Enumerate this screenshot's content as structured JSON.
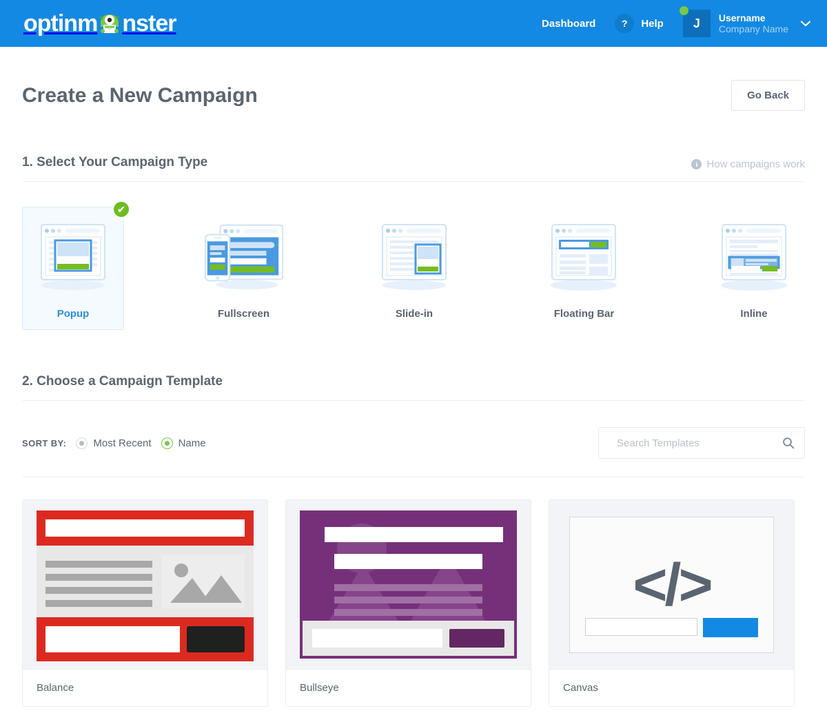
{
  "header": {
    "logo_text_before": "optinm",
    "logo_icon": "monster-mascot",
    "logo_text_after": "nster",
    "dashboard_label": "Dashboard",
    "help_icon": "?",
    "help_label": "Help",
    "avatar_initial": "J",
    "user_name": "Username",
    "company_name": "Company Name",
    "chevron": "⌄",
    "brand_blue": "#1389e3",
    "status_color": "#7ac943"
  },
  "page": {
    "title": "Create a New Campaign",
    "go_back_label": "Go Back"
  },
  "step1": {
    "title": "1. Select Your Campaign Type",
    "how_link_label": "How campaigns work",
    "info_icon": "i",
    "check_icon": "✔",
    "types": [
      {
        "label": "Popup",
        "icon": "popup-type-icon",
        "selected": true
      },
      {
        "label": "Fullscreen",
        "icon": "fullscreen-type-icon",
        "selected": false
      },
      {
        "label": "Slide-in",
        "icon": "slidein-type-icon",
        "selected": false
      },
      {
        "label": "Floating Bar",
        "icon": "floatingbar-type-icon",
        "selected": false
      },
      {
        "label": "Inline",
        "icon": "inline-type-icon",
        "selected": false
      }
    ]
  },
  "step2": {
    "title": "2. Choose a Campaign Template",
    "sort_label": "SORT BY:",
    "sort_options": [
      {
        "label": "Most Recent",
        "selected": false
      },
      {
        "label": "Name",
        "selected": true
      }
    ],
    "search": {
      "placeholder": "Search Templates",
      "value": "",
      "icon": "search-icon"
    },
    "templates": [
      {
        "name": "Balance",
        "accent": "#dd2a21",
        "button_color": "#1f211f"
      },
      {
        "name": "Bullseye",
        "accent": "#76307a",
        "button_color": "#632864"
      },
      {
        "name": "Canvas",
        "accent": "#fbfbfb",
        "button_color": "#1389e3",
        "glyph": "</>"
      }
    ]
  }
}
